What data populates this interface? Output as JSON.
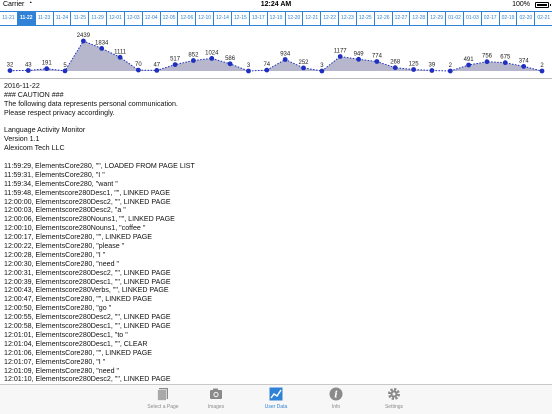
{
  "status_bar": {
    "carrier": "Carrier",
    "time": "12:24 AM",
    "battery": "100%"
  },
  "date_tabs": {
    "selected": "11-22",
    "items": [
      "11-21",
      "11-22",
      "11-23",
      "11-24",
      "11-25",
      "11-29",
      "12-01",
      "12-03",
      "12-04",
      "12-05",
      "12-06",
      "12-10",
      "12-14",
      "12-15",
      "13-17",
      "12-19",
      "12-20",
      "12-21",
      "12-22",
      "12-23",
      "12-25",
      "12-26",
      "12-27",
      "12-28",
      "12-29",
      "01-02",
      "01-03",
      "02-17",
      "02-19",
      "02-20",
      "02-21"
    ]
  },
  "chart_data": {
    "type": "area",
    "values": [
      32,
      43,
      191,
      5,
      2439,
      1834,
      1111,
      70,
      47,
      517,
      852,
      1024,
      586,
      3,
      74,
      934,
      252,
      3,
      1177,
      949,
      774,
      268,
      125,
      39,
      2,
      491,
      756,
      675,
      374,
      2
    ],
    "labels": [
      "32",
      "43",
      "191",
      "5",
      "2439",
      "1834",
      "1111",
      "70",
      "47",
      "517",
      "852",
      "1024",
      "586",
      "3",
      "74",
      "934",
      "252",
      "3",
      "1177",
      "949",
      "774",
      "268",
      "125",
      "39",
      "2",
      "491",
      "756",
      "675",
      "374",
      "2"
    ]
  },
  "log_lines": [
    "2016-11-22",
    "### CAUTION ###",
    "The following data represents personal communication.",
    "Please respect privacy accordingly.",
    "",
    "Language Activity Monitor",
    "Version 1.1",
    "Alexicom Tech LLC",
    "",
    "11:59:29, ElementsCore280, \"\", LOADED FROM PAGE LIST",
    "11:59:31, ElementsCore280, \"I \"",
    "11:59:34, ElementsCore280, \"want \"",
    "11:59:48, Elementscore280Desc1, \"\", LINKED PAGE",
    "12:00:00, Elementscore280Desc2, \"\", LINKED PAGE",
    "12:00:03, Elementscore280Desc2, \"a \"",
    "12:00:06, Elementscore280Nouns1, \"\", LINKED PAGE",
    "12:00:10, Elementscore280Nouns1, \"coffee \"",
    "12:00:17, ElementsCore280, \"\", LINKED PAGE",
    "12:00:22, ElementsCore280, \"please \"",
    "12:00:28, ElementsCore280, \"I \"",
    "12:00:30, ElementsCore280, \"need \"",
    "12:00:31, Elementscore280Desc2, \"\", LINKED PAGE",
    "12:00:39, Elementscore280Desc1, \"\", LINKED PAGE",
    "12:00:43, Elementscore280Verbs, \"\", LINKED PAGE",
    "12:00:47, ElementsCore280, \"\", LINKED PAGE",
    "12:00:50, ElementsCore280, \"go \"",
    "12:00:55, Elementscore280Desc2, \"\", LINKED PAGE",
    "12:00:58, Elementscore280Desc1, \"\", LINKED PAGE",
    "12:01:01, Elementscore280Desc1, \"to \"",
    "12:01:04, Elementscore280Desc1, \"\", CLEAR",
    "12:01:06, ElementsCore280, \"\", LINKED PAGE",
    "12:01:07, ElementsCore280, \"I \"",
    "12:01:09, ElementsCore280, \"need \"",
    "12:01:10, Elementscore280Desc2, \"\", LINKED PAGE"
  ],
  "tab_bar": {
    "items": [
      {
        "label": "Select a Page",
        "icon": "pages-icon"
      },
      {
        "label": "Images",
        "icon": "camera-icon"
      },
      {
        "label": "User Data",
        "icon": "chart-icon",
        "active": true
      },
      {
        "label": "Info",
        "icon": "info-icon"
      },
      {
        "label": "Settings",
        "icon": "gear-icon"
      }
    ]
  },
  "colors": {
    "accent": "#2f82d6",
    "chart_fill": "#a9a9c4",
    "point": "#1f2fbf"
  }
}
